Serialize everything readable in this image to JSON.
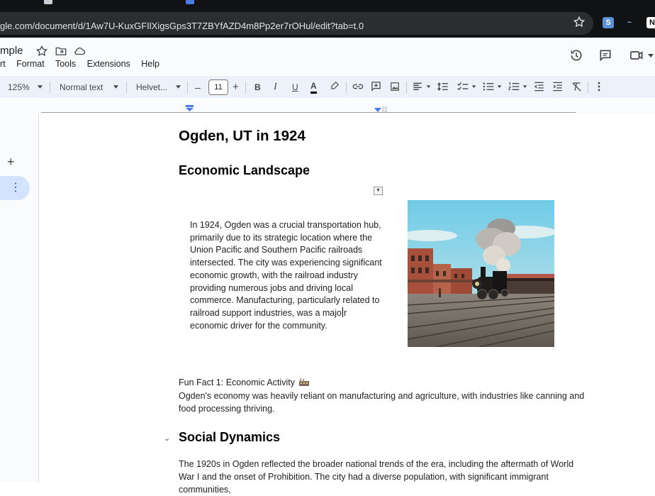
{
  "browser": {
    "url": "gle.com/document/d/1Aw7U-KuxGFIlXigsGps3T7ZBYfAZD4m8Pp2er7rOHul/edit?tab=t.0",
    "extensions": [
      "S",
      "~",
      "N"
    ]
  },
  "docs": {
    "title": "mple",
    "menu": [
      "rt",
      "Format",
      "Tools",
      "Extensions",
      "Help"
    ]
  },
  "toolbar": {
    "zoom": "125%",
    "style": "Normal text",
    "font": "Helvet...",
    "font_size": "11",
    "minus": "–",
    "plus": "+",
    "bold": "B",
    "italic": "I",
    "underline": "U",
    "text_color": "A"
  },
  "left_panel": {
    "add": "+",
    "more": "⋮"
  },
  "document": {
    "title": "Ogden, UT in 1924",
    "section1_heading": "Economic Landscape",
    "section1_paragraph_before_cursor": "In 1924, Ogden was a crucial transportation hub, primarily due to its strategic location where the Union Pacific and Southern Pacific railroads intersected. The city was experiencing significant economic growth, with the railroad industry providing numerous jobs and driving local commerce. Manufacturing, particularly related to railroad support industries, was a majo",
    "section1_paragraph_after_cursor": "r economic driver for the community.",
    "fun_fact_label": "Fun Fact 1: Economic Activity",
    "fun_fact_text": "Ogden's economy was heavily reliant on manufacturing and agriculture, with industries like canning and food processing thriving.",
    "section2_heading": "Social Dynamics",
    "section2_paragraph": "The 1920s in Ogden reflected the broader national trends of the era, including the aftermath of World War I and the onset of Prohibition. The city had a diverse population, with significant immigrant communities,"
  },
  "colors": {
    "toolbar_bg": "#edf2fa",
    "header_bg": "#f9fbfd",
    "accent": "#0b57d0",
    "chrome_dark": "#111214"
  }
}
